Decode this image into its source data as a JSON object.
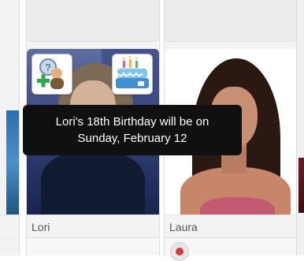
{
  "cards": [
    {
      "name": "Lori"
    },
    {
      "name": "Laura"
    }
  ],
  "tooltip": {
    "line1": "Lori's 18th Birthday will be on",
    "line2": "Sunday, February 12"
  },
  "icons": {
    "add_user": "add-user-icon",
    "birthday": "birthday-cake-icon",
    "status_badge": "red-dot-icon"
  },
  "colors": {
    "tooltip_bg": "#101010",
    "badge_red": "#d63b3b"
  }
}
